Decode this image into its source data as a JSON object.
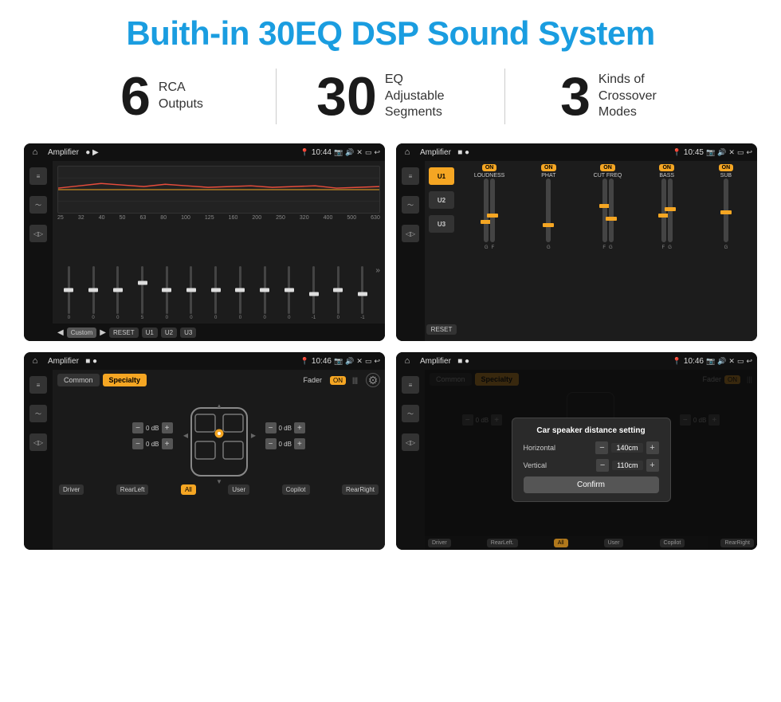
{
  "header": {
    "title": "Buith-in 30EQ DSP Sound System"
  },
  "stats": [
    {
      "number": "6",
      "label": "RCA\nOutputs"
    },
    {
      "number": "30",
      "label": "EQ Adjustable\nSegments"
    },
    {
      "number": "3",
      "label": "Kinds of\nCrossover Modes"
    }
  ],
  "screens": {
    "eq": {
      "status_bar": {
        "title": "Amplifier",
        "time": "10:44"
      },
      "freq_labels": [
        "25",
        "32",
        "40",
        "50",
        "63",
        "80",
        "100",
        "125",
        "160",
        "200",
        "250",
        "320",
        "400",
        "500",
        "630"
      ],
      "slider_values": [
        "0",
        "0",
        "0",
        "5",
        "0",
        "0",
        "0",
        "0",
        "0",
        "0",
        "-1",
        "0",
        "-1"
      ],
      "buttons": [
        "Custom",
        "RESET",
        "U1",
        "U2",
        "U3"
      ]
    },
    "dsp": {
      "status_bar": {
        "title": "Amplifier",
        "time": "10:45"
      },
      "presets": [
        "U1",
        "U2",
        "U3"
      ],
      "controls": [
        {
          "label": "LOUDNESS",
          "toggle": "ON"
        },
        {
          "label": "PHAT",
          "toggle": "ON"
        },
        {
          "label": "CUT FREQ",
          "toggle": "ON"
        },
        {
          "label": "BASS",
          "toggle": "ON"
        },
        {
          "label": "SUB",
          "toggle": "ON"
        }
      ],
      "reset_label": "RESET"
    },
    "speaker": {
      "status_bar": {
        "title": "Amplifier",
        "time": "10:46"
      },
      "tabs": [
        "Common",
        "Specialty"
      ],
      "fader_label": "Fader",
      "fader_toggle": "ON",
      "db_values": [
        "0 dB",
        "0 dB",
        "0 dB",
        "0 dB"
      ],
      "buttons": [
        "Driver",
        "RearLeft",
        "All",
        "User",
        "Copilot",
        "RearRight"
      ]
    },
    "dialog": {
      "status_bar": {
        "title": "Amplifier",
        "time": "10:46"
      },
      "tabs": [
        "Common",
        "Specialty"
      ],
      "dialog_title": "Car speaker distance setting",
      "horizontal_label": "Horizontal",
      "horizontal_value": "140cm",
      "vertical_label": "Vertical",
      "vertical_value": "110cm",
      "confirm_label": "Confirm",
      "db_values": [
        "0 dB",
        "0 dB"
      ],
      "buttons": [
        "Driver",
        "RearLeft.",
        "All",
        "User",
        "Copilot",
        "RearRight"
      ]
    }
  },
  "colors": {
    "accent": "#f5a623",
    "blue": "#1a9de0",
    "dark_bg": "#1a1a1a",
    "darker_bg": "#111111"
  }
}
